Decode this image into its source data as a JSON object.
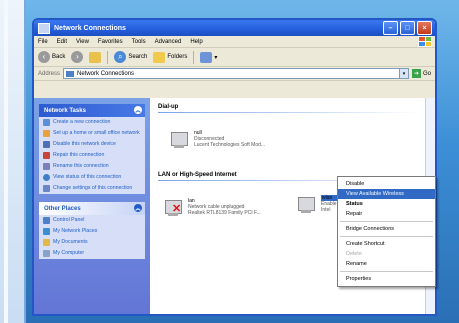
{
  "window": {
    "title": "Network Connections"
  },
  "menu": [
    "File",
    "Edit",
    "View",
    "Favorites",
    "Tools",
    "Advanced",
    "Help"
  ],
  "toolbar": {
    "back": "Back",
    "search": "Search",
    "folders": "Folders"
  },
  "address": {
    "label": "Address",
    "value": "Network Connections",
    "go": "Go"
  },
  "taskpane": {
    "network_tasks": {
      "title": "Network Tasks",
      "items": [
        "Create a new connection",
        "Set up a home or small office network",
        "Disable this network device",
        "Repair this connection",
        "Rename this connection",
        "View status of this connection",
        "Change settings of this connection"
      ]
    },
    "other_places": {
      "title": "Other Places",
      "items": [
        "Control Panel",
        "My Network Places",
        "My Documents",
        "My Computer"
      ]
    }
  },
  "sections": {
    "dialup": "Dial-up",
    "lan": "LAN or High-Speed Internet"
  },
  "connections": {
    "dialup": {
      "name": "null",
      "line1": "Disconnected",
      "line2": "Lucent Technologies Soft Mod..."
    },
    "lan": {
      "name": "lan",
      "line1": "Network cable unplugged",
      "line2": "Realtek RTL8139 Family PCI F..."
    },
    "wlan": {
      "name": "wlan",
      "line1": "Enable",
      "line2": "Intel"
    }
  },
  "context_menu": {
    "items": [
      "Disable",
      "View Available Wireless Networks",
      "Status",
      "Repair",
      "Bridge Connections",
      "Create Shortcut",
      "Delete",
      "Rename",
      "Properties"
    ]
  },
  "colors": {
    "titlebar": "#245edb",
    "taskpane": "#6375d6",
    "highlight": "#316ac5"
  }
}
